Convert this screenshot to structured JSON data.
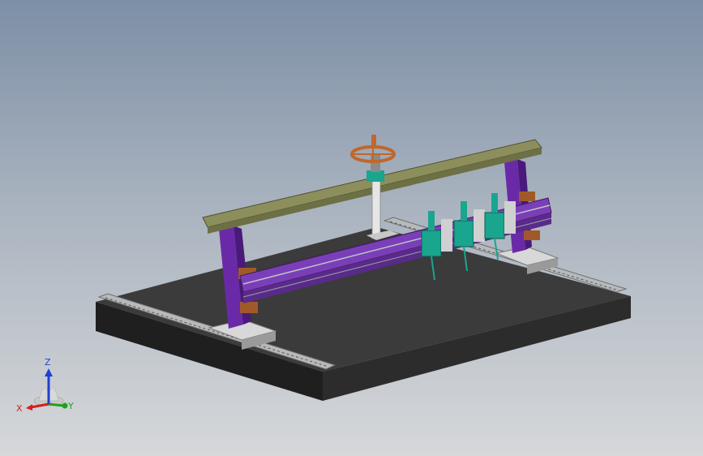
{
  "triad": {
    "x_label": "X",
    "y_label": "Y",
    "z_label": "Z"
  },
  "colors": {
    "background_top": "#7d8fa6",
    "background_bottom": "#d6d8da",
    "base_top": "#3a3a3a",
    "base_side": "#232323",
    "beam": "#8c8f5c",
    "column": "#6a2aa8",
    "rail": "#b8bcc0",
    "handwheel": "#c0672a",
    "motor": "#1aa58f",
    "axis_x": "#d21f1f",
    "axis_y": "#20a020",
    "axis_z": "#1f3fd2"
  }
}
